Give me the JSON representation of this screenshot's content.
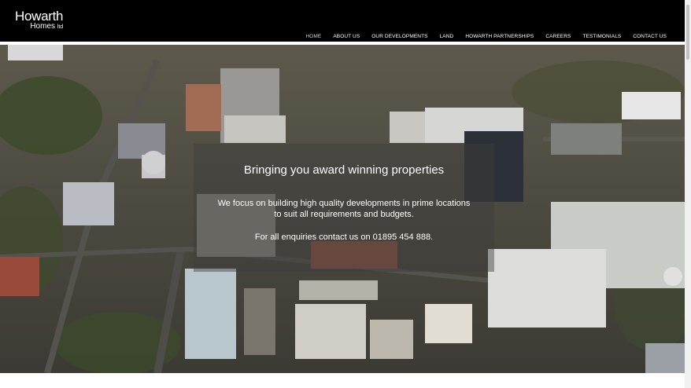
{
  "brand": {
    "line1": "Howarth",
    "line2": "Homes",
    "suffix": "ltd"
  },
  "nav": {
    "items": [
      {
        "label": "HOME"
      },
      {
        "label": "ABOUT US"
      },
      {
        "label": "OUR DEVELOPMENTS"
      },
      {
        "label": "LAND"
      },
      {
        "label": "HOWARTH PARTNERSHIPS"
      },
      {
        "label": "CAREERS"
      },
      {
        "label": "TESTIMONIALS"
      },
      {
        "label": "CONTACT US"
      }
    ]
  },
  "hero": {
    "tagline": "Bringing you award winning properties",
    "description_line1": "We focus on building high quality developments in prime locations",
    "description_line2": "to suit all requirements and budgets.",
    "contact": "For all enquiries contact us on 01895 454 888."
  },
  "colors": {
    "header_bg": "#000000",
    "text": "#ffffff",
    "page_bg": "#ffffff"
  }
}
